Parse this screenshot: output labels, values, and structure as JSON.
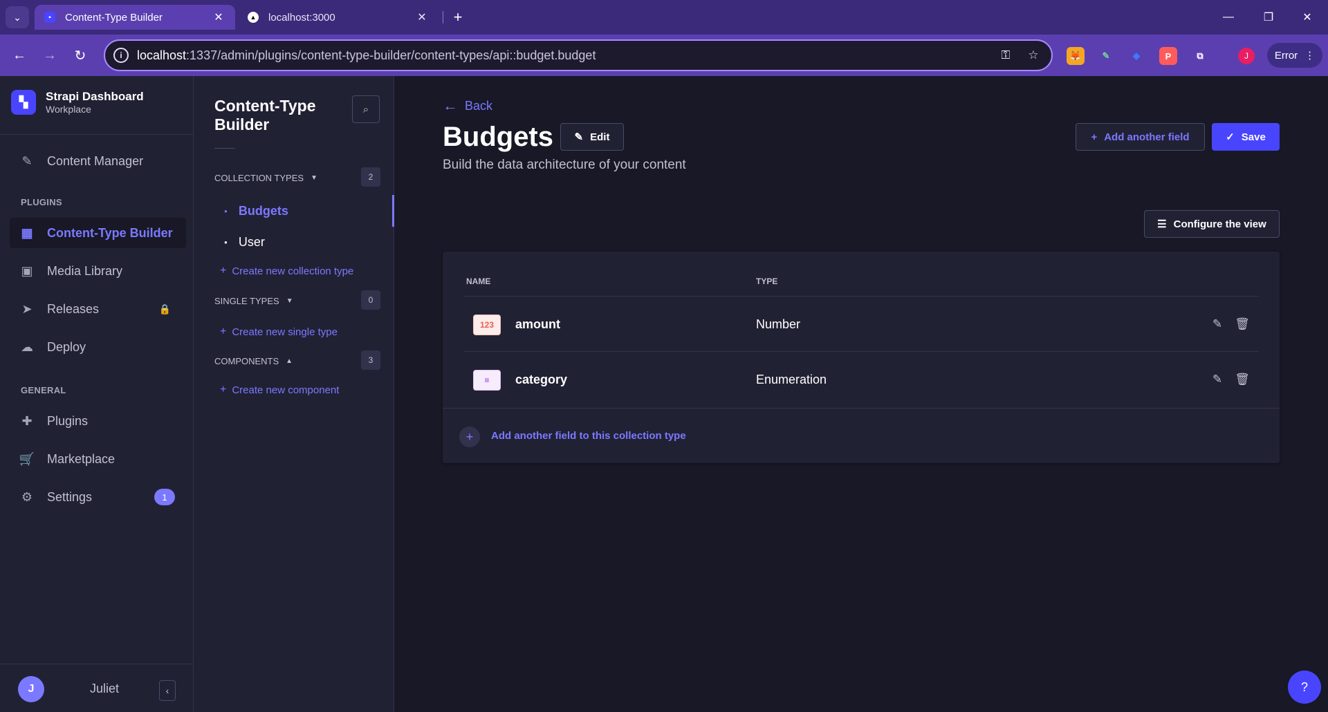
{
  "browser": {
    "tabs": [
      {
        "title": "Content-Type Builder",
        "active": true,
        "icon": "strapi-favicon"
      },
      {
        "title": "localhost:3000",
        "active": false,
        "icon": "vercel-favicon"
      }
    ],
    "url_host": "localhost",
    "url_path": ":1337/admin/plugins/content-type-builder/content-types/api::budget.budget",
    "profile_initial": "J",
    "error_label": "Error"
  },
  "brand": {
    "title": "Strapi Dashboard",
    "subtitle": "Workplace"
  },
  "mainnav": {
    "content_manager": "Content Manager",
    "plugins_section": "PLUGINS",
    "content_type_builder": "Content-Type Builder",
    "media_library": "Media Library",
    "releases": "Releases",
    "deploy": "Deploy",
    "general_section": "GENERAL",
    "plugins": "Plugins",
    "marketplace": "Marketplace",
    "settings": "Settings",
    "settings_badge": "1",
    "user_initial": "J",
    "user_name": "Juliet"
  },
  "subnav": {
    "title": "Content-Type Builder",
    "collection_types": {
      "label": "COLLECTION TYPES",
      "count": "2",
      "items": [
        "Budgets",
        "User"
      ],
      "create": "Create new collection type"
    },
    "single_types": {
      "label": "SINGLE TYPES",
      "count": "0",
      "create": "Create new single type"
    },
    "components": {
      "label": "COMPONENTS",
      "count": "3",
      "create": "Create new component"
    }
  },
  "main": {
    "back": "Back",
    "title": "Budgets",
    "edit": "Edit",
    "subtitle": "Build the data architecture of your content",
    "add_field": "Add another field",
    "save": "Save",
    "configure": "Configure the view",
    "table": {
      "headers": [
        "NAME",
        "TYPE"
      ],
      "rows": [
        {
          "name": "amount",
          "type": "Number",
          "icon_label": "123",
          "icon_color": "#ee5e52",
          "icon_bg": "#fcecea"
        },
        {
          "name": "category",
          "type": "Enumeration",
          "icon_label": "≡",
          "icon_color": "#9736e8",
          "icon_bg": "#f6ecfc"
        }
      ],
      "add_footer": "Add another field to this collection type"
    }
  },
  "help": "?"
}
